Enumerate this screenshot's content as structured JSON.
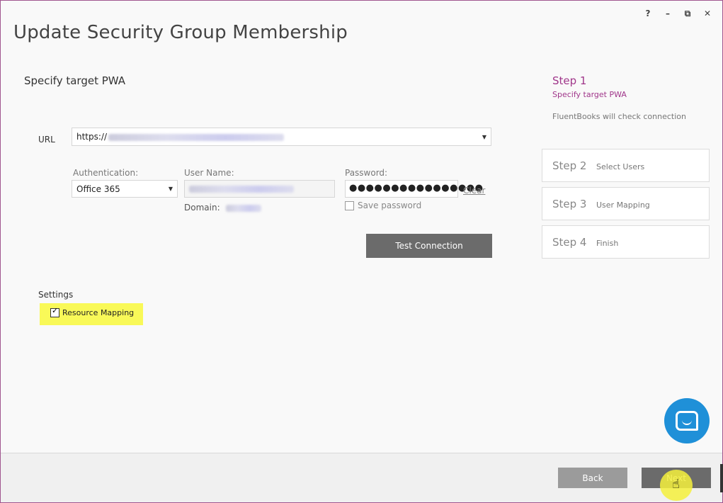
{
  "window": {
    "title": "Update Security Group Membership",
    "controls": {
      "help": "?",
      "minimize": "–",
      "restore": "⧉",
      "close": "✕"
    }
  },
  "form": {
    "section_title": "Specify target PWA",
    "url_label": "URL",
    "url_prefix": "https://",
    "authentication_label": "Authentication:",
    "authentication_value": "Office 365",
    "username_label": "User Name:",
    "domain_label": "Domain:",
    "password_label": "Password:",
    "password_value": "●●●●●●●●●●●●●●●●",
    "clear_link": "Clear",
    "save_password_label": "Save password",
    "test_connection_button": "Test Connection"
  },
  "settings": {
    "label": "Settings",
    "resource_mapping_label": "Resource Mapping",
    "resource_mapping_checked": true,
    "highlight_color": "#f9f958"
  },
  "steps": {
    "active": {
      "num": "Step 1",
      "desc": "Specify target PWA",
      "info": "FluentBooks will check connection"
    },
    "items": [
      {
        "num": "Step 2",
        "desc": "Select Users"
      },
      {
        "num": "Step 3",
        "desc": "User Mapping"
      },
      {
        "num": "Step 4",
        "desc": "Finish"
      }
    ],
    "accent_color": "#a0368a"
  },
  "footer": {
    "back_button": "Back",
    "next_button": "Next"
  },
  "chat": {
    "icon": "chat-icon",
    "color": "#1f90d8"
  }
}
